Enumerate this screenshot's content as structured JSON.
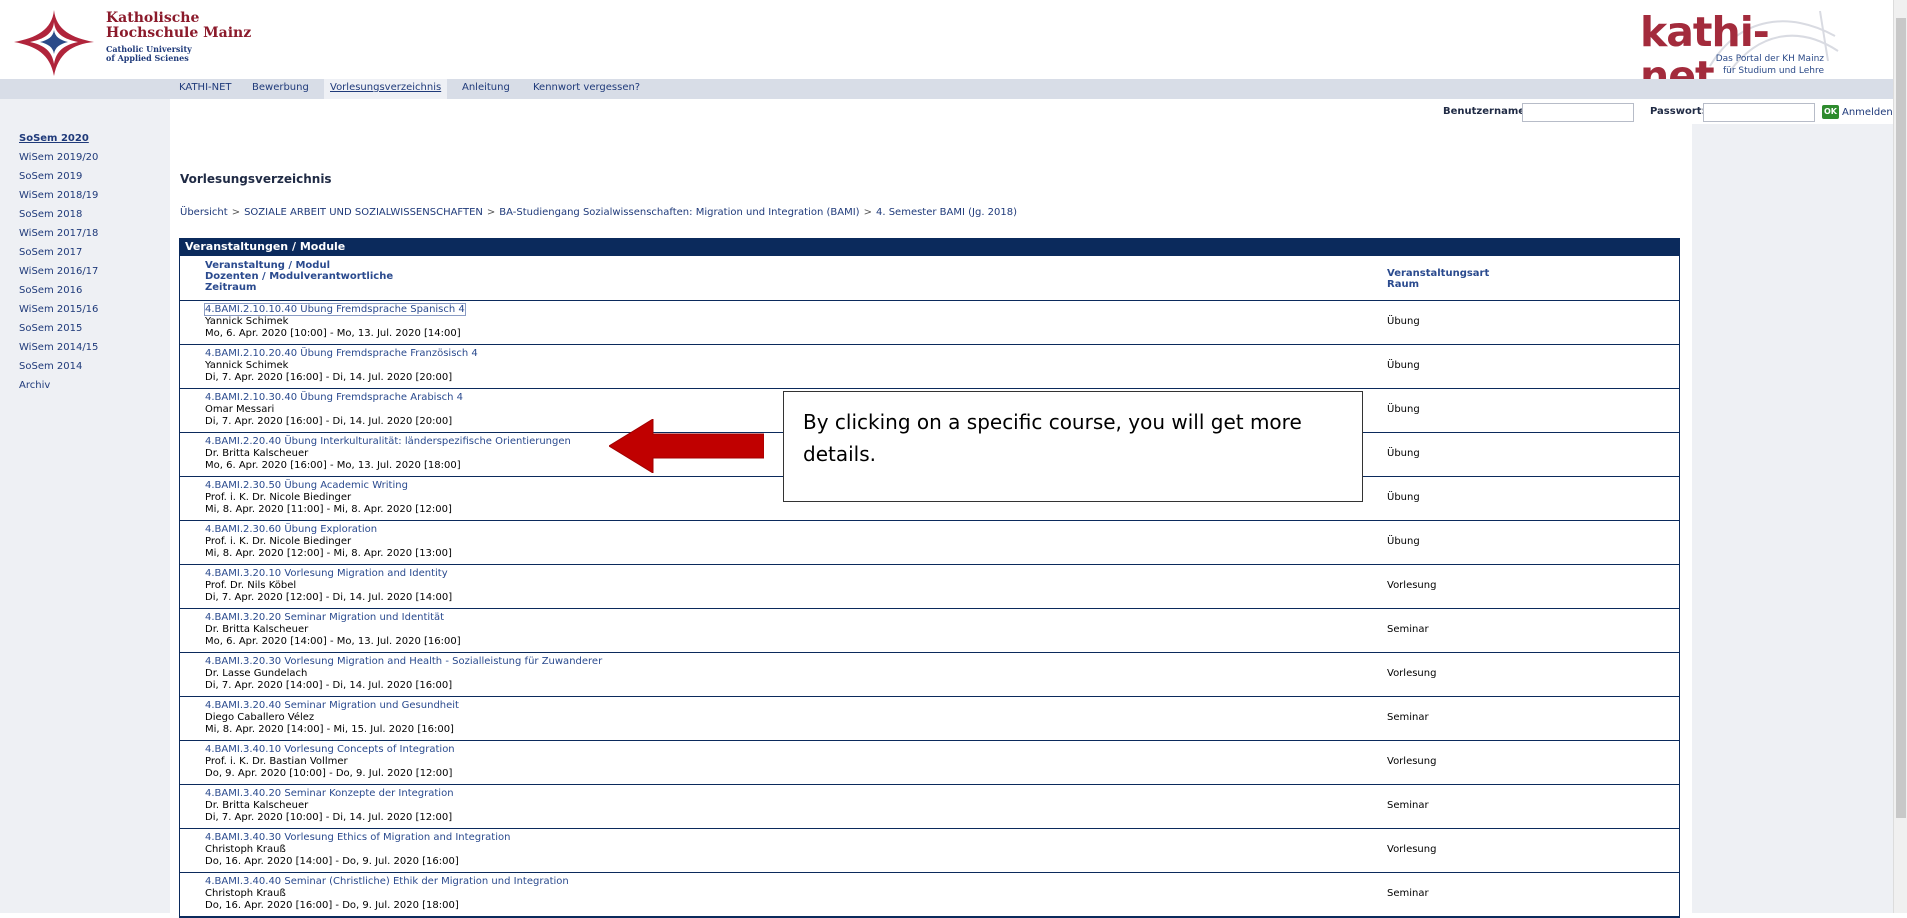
{
  "header": {
    "university_line1": "Katholische",
    "university_line2": "Hochschule Mainz",
    "university_line3": "Catholic University",
    "university_line4": "of Applied Scienes",
    "brand_title": "kathi-net",
    "brand_sub1": "Das Portal der KH Mainz",
    "brand_sub2": "für Studium und Lehre"
  },
  "nav": {
    "items": [
      "KATHI-NET",
      "Bewerbung",
      "Vorlesungsverzeichnis",
      "Anleitung",
      "Kennwort vergessen?"
    ],
    "active": "Vorlesungsverzeichnis"
  },
  "login": {
    "username_label": "Benutzername:",
    "password_label": "Passwort:",
    "ok_label": "OK",
    "submit_label": "Anmelden"
  },
  "semesters": [
    "SoSem 2020",
    "WiSem 2019/20",
    "SoSem 2019",
    "WiSem 2018/19",
    "SoSem 2018",
    "WiSem 2017/18",
    "SoSem 2017",
    "WiSem 2016/17",
    "SoSem 2016",
    "WiSem 2015/16",
    "SoSem 2015",
    "WiSem 2014/15",
    "SoSem 2014",
    "Archiv"
  ],
  "main": {
    "title": "Vorlesungsverzeichnis",
    "breadcrumb": [
      "Übersicht",
      "SOZIALE ARBEIT UND SOZIALWISSENSCHAFTEN",
      "BA-Studiengang Sozialwissenschaften: Migration und Integration (BAMI)",
      "4. Semester BAMI (Jg. 2018)"
    ],
    "breadcrumb_sep": ">"
  },
  "table": {
    "heading": "Veranstaltungen / Module",
    "col_titles": [
      "Veranstaltung / Modul",
      "Dozenten / Modulverantwortliche",
      "Zeitraum"
    ],
    "col_type": [
      "Veranstaltungsart",
      "Raum"
    ],
    "rows": [
      {
        "title": "4.BAMI.2.10.10.40 Übung Fremdsprache Spanisch 4",
        "person": "Yannick Schimek",
        "time": "Mo, 6. Apr. 2020 [10:00] - Mo, 13. Jul. 2020 [14:00]",
        "type": "Übung"
      },
      {
        "title": "4.BAMI.2.10.20.40 Übung Fremdsprache Französisch 4",
        "person": "Yannick Schimek",
        "time": "Di, 7. Apr. 2020 [16:00] - Di, 14. Jul. 2020 [20:00]",
        "type": "Übung"
      },
      {
        "title": "4.BAMI.2.10.30.40 Übung Fremdsprache Arabisch 4",
        "person": "Omar Messari",
        "time": "Di, 7. Apr. 2020 [16:00] - Di, 14. Jul. 2020 [20:00]",
        "type": "Übung"
      },
      {
        "title": "4.BAMI.2.20.40 Übung Interkulturalität: länderspezifische Orientierungen",
        "person": "Dr. Britta Kalscheuer",
        "time": "Mo, 6. Apr. 2020 [16:00] - Mo, 13. Jul. 2020 [18:00]",
        "type": "Übung"
      },
      {
        "title": "4.BAMI.2.30.50 Übung Academic Writing",
        "person": "Prof. i. K. Dr. Nicole Biedinger",
        "time": "Mi, 8. Apr. 2020 [11:00] - Mi, 8. Apr. 2020 [12:00]",
        "type": "Übung"
      },
      {
        "title": "4.BAMI.2.30.60 Übung Exploration",
        "person": "Prof. i. K. Dr. Nicole Biedinger",
        "time": "Mi, 8. Apr. 2020 [12:00] - Mi, 8. Apr. 2020 [13:00]",
        "type": "Übung"
      },
      {
        "title": "4.BAMI.3.20.10 Vorlesung Migration and Identity",
        "person": "Prof. Dr. Nils Köbel",
        "time": "Di, 7. Apr. 2020 [12:00] - Di, 14. Jul. 2020 [14:00]",
        "type": "Vorlesung"
      },
      {
        "title": "4.BAMI.3.20.20 Seminar Migration und Identität",
        "person": "Dr. Britta Kalscheuer",
        "time": "Mo, 6. Apr. 2020 [14:00] - Mo, 13. Jul. 2020 [16:00]",
        "type": "Seminar"
      },
      {
        "title": "4.BAMI.3.20.30 Vorlesung Migration and Health - Sozialleistung für Zuwanderer",
        "person": "Dr. Lasse Gundelach",
        "time": "Di, 7. Apr. 2020 [14:00] - Di, 14. Jul. 2020 [16:00]",
        "type": "Vorlesung"
      },
      {
        "title": "4.BAMI.3.20.40 Seminar Migration und Gesundheit",
        "person": "Diego Caballero Vélez",
        "time": "Mi, 8. Apr. 2020 [14:00] - Mi, 15. Jul. 2020 [16:00]",
        "type": "Seminar"
      },
      {
        "title": "4.BAMI.3.40.10 Vorlesung Concepts of Integration",
        "person": "Prof. i. K. Dr. Bastian Vollmer",
        "time": "Do, 9. Apr. 2020 [10:00] - Do, 9. Jul. 2020 [12:00]",
        "type": "Vorlesung"
      },
      {
        "title": "4.BAMI.3.40.20 Seminar Konzepte der Integration",
        "person": "Dr. Britta Kalscheuer",
        "time": "Di, 7. Apr. 2020 [10:00] - Di, 14. Jul. 2020 [12:00]",
        "type": "Seminar"
      },
      {
        "title": "4.BAMI.3.40.30 Vorlesung Ethics of Migration and Integration",
        "person": "Christoph Krauß",
        "time": "Do, 16. Apr. 2020 [14:00] - Do, 9. Jul. 2020 [16:00]",
        "type": "Vorlesung"
      },
      {
        "title": "4.BAMI.3.40.40 Seminar (Christliche) Ethik der Migration und Integration",
        "person": "Christoph Krauß",
        "time": "Do, 16. Apr. 2020 [16:00] - Do, 9. Jul. 2020 [18:00]",
        "type": "Seminar"
      }
    ]
  },
  "callout": {
    "text": "By clicking on a specific course, you will get more details."
  },
  "colors": {
    "header_blue": "#0b2a5c",
    "link_blue": "#2a4a8e",
    "brand_red": "#a32b3c",
    "arrow_red": "#c00000",
    "nav_bg": "#d8dde7",
    "side_bg": "#eef0f4"
  }
}
